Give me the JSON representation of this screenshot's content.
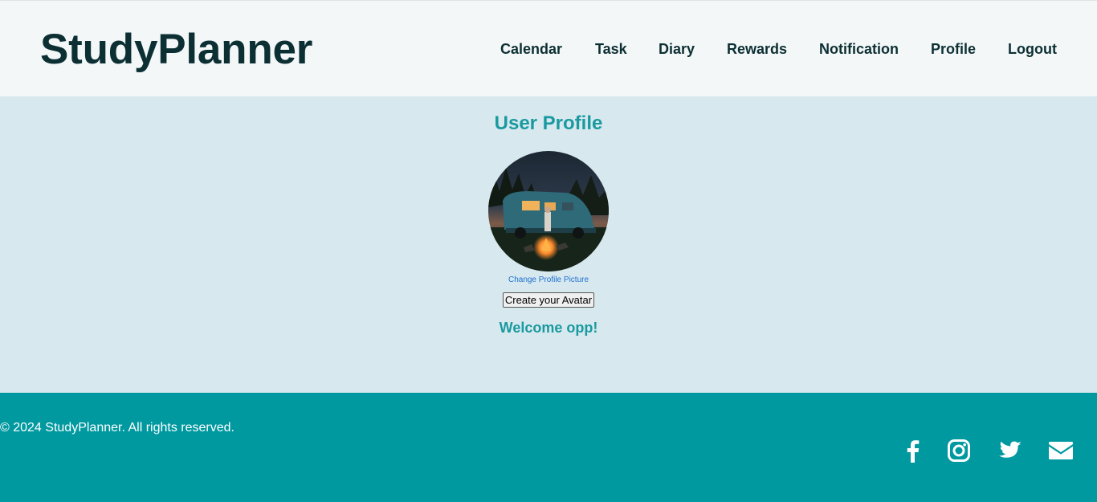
{
  "brand": {
    "name": "StudyPlanner"
  },
  "nav": {
    "items": [
      {
        "label": "Calendar"
      },
      {
        "label": "Task"
      },
      {
        "label": "Diary"
      },
      {
        "label": "Rewards"
      },
      {
        "label": "Notification"
      },
      {
        "label": "Profile"
      },
      {
        "label": "Logout"
      }
    ]
  },
  "profile": {
    "title": "User Profile",
    "avatar_icon": "profile-picture",
    "change_picture_label": "Change Profile Picture",
    "create_avatar_label": "Create your Avatar",
    "welcome_text": "Welcome opp!"
  },
  "footer": {
    "copyright": "© 2024 StudyPlanner. All rights reserved.",
    "social_icons": [
      "facebook-icon",
      "instagram-icon",
      "twitter-icon",
      "email-icon"
    ]
  },
  "colors": {
    "header_bg": "#f3f7f8",
    "main_bg": "#d7e9ee",
    "accent": "#1a9aa0",
    "footer_bg": "#0099a0",
    "dark_text": "#0c2f33",
    "link": "#1f6fd0"
  }
}
